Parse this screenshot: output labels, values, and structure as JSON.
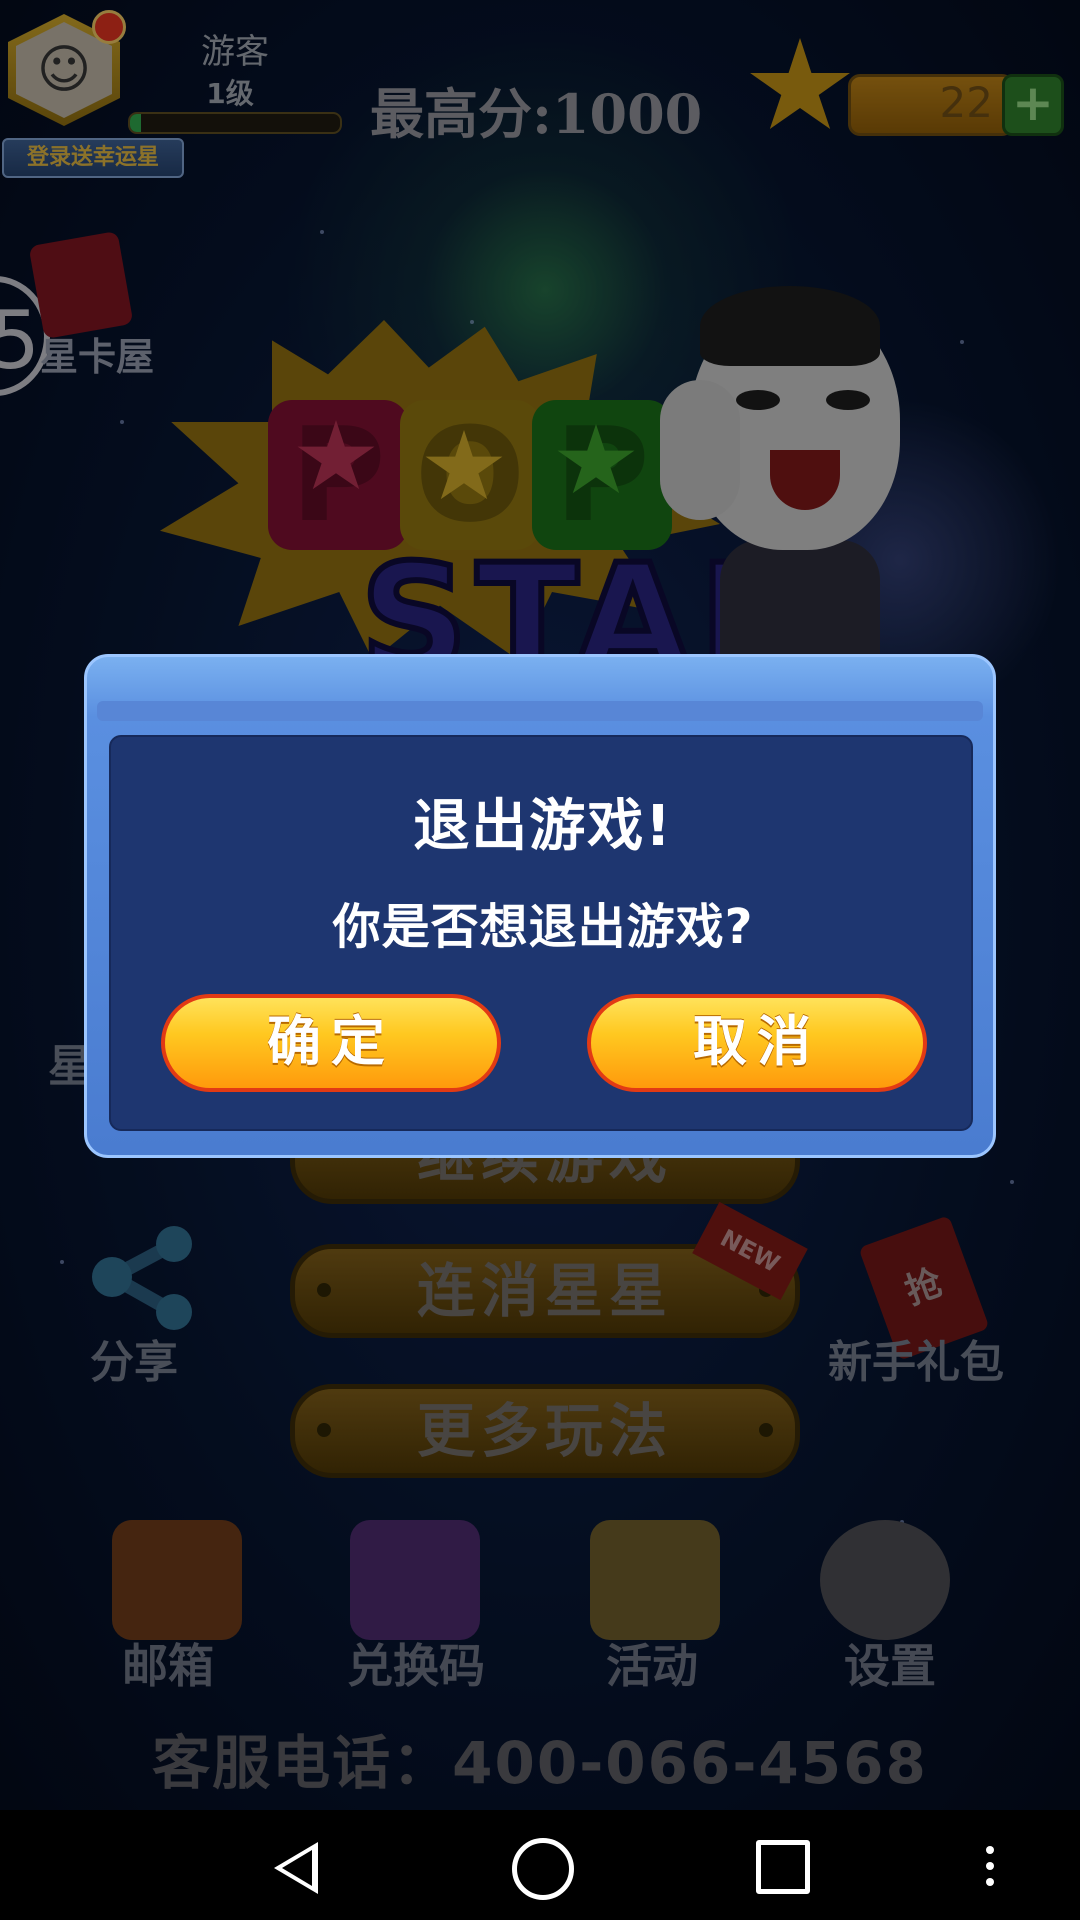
{
  "user": {
    "name": "游客",
    "level": "1级",
    "level_progress": 0.05,
    "login_promo": "登录送幸运星"
  },
  "high_score": {
    "label": "最高分:1000"
  },
  "stars": {
    "count": "22",
    "plus_label": "+"
  },
  "side": {
    "circle_number": "5",
    "card_house_label": "星卡屋",
    "star_label": "星"
  },
  "logo": {
    "pop_letters": [
      "P",
      "O",
      "P"
    ],
    "star_word": "STAR"
  },
  "menu": {
    "continue_label": "继续游戏",
    "combo_label": "连消星星",
    "more_modes_label": "更多玩法",
    "new_tag": "NEW"
  },
  "share": {
    "label": "分享"
  },
  "newbie_gift": {
    "label": "新手礼包",
    "badge": "抢"
  },
  "bottom": [
    {
      "label": "邮箱",
      "icon": "mailbox-icon"
    },
    {
      "label": "兑换码",
      "icon": "gift-box-icon"
    },
    {
      "label": "活动",
      "icon": "megaphone-icon"
    },
    {
      "label": "设置",
      "icon": "gear-icon"
    }
  ],
  "hotline": "客服电话：400-066-4568",
  "dialog": {
    "title": "退出游戏!",
    "message": "你是否想退出游戏?",
    "confirm_label": "确定",
    "cancel_label": "取消"
  },
  "colors": {
    "dialog_frame": "#5a8fe0",
    "dialog_panel": "#1e3670",
    "button_fill": "#ffc820",
    "button_border": "#e23a14"
  }
}
